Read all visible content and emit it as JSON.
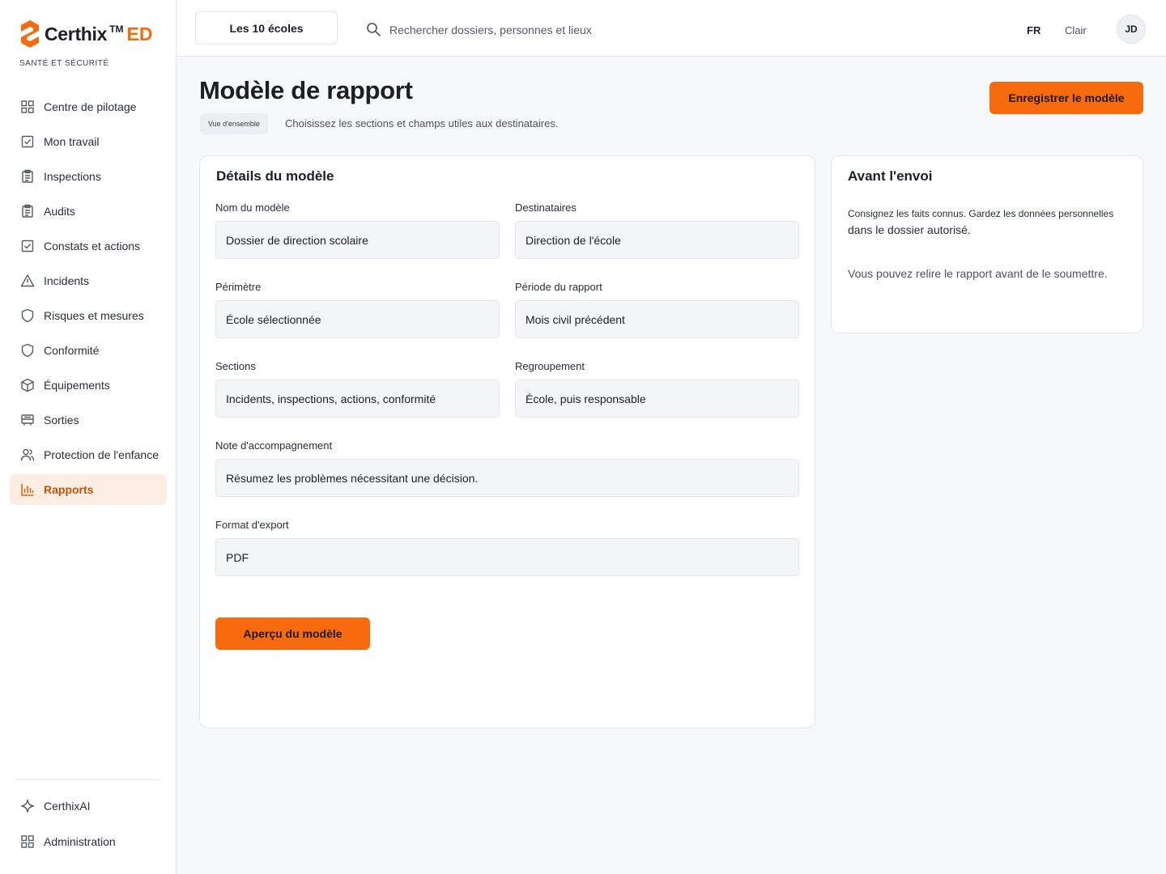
{
  "brand": {
    "name": "Certhix",
    "tm": "TM",
    "suffix": "ED",
    "subtitle": "SANTÉ ET SÉCURITÉ",
    "accent": "#f26b0f"
  },
  "sidebar": {
    "items": [
      {
        "label": "Centre de pilotage",
        "icon": "grid-icon",
        "active": false
      },
      {
        "label": "Mon travail",
        "icon": "checkbox-icon",
        "active": false
      },
      {
        "label": "Inspections",
        "icon": "clipboard-icon",
        "active": false
      },
      {
        "label": "Audits",
        "icon": "clipboard-icon",
        "active": false
      },
      {
        "label": "Constats et actions",
        "icon": "checkbox-icon",
        "active": false
      },
      {
        "label": "Incidents",
        "icon": "warning-icon",
        "active": false
      },
      {
        "label": "Risques et mesures",
        "icon": "shield-icon",
        "active": false
      },
      {
        "label": "Conformité",
        "icon": "shield-icon",
        "active": false
      },
      {
        "label": "Équipements",
        "icon": "box-icon",
        "active": false
      },
      {
        "label": "Sorties",
        "icon": "bus-icon",
        "active": false
      },
      {
        "label": "Protection de l'enfance",
        "icon": "users-icon",
        "active": false
      },
      {
        "label": "Rapports",
        "icon": "bar-chart-icon",
        "active": true
      }
    ],
    "bottom": [
      {
        "label": "CerthixAI",
        "icon": "sparkle-icon"
      },
      {
        "label": "Administration",
        "icon": "grid-icon"
      }
    ]
  },
  "topbar": {
    "school_selector": "Les 10 écoles",
    "search_placeholder": "Rechercher dossiers, personnes et lieux",
    "language": "FR",
    "theme": "Clair",
    "avatar_initials": "JD"
  },
  "page": {
    "title": "Modèle de rapport",
    "badge": "Vue d'ensemble",
    "subtitle": "Choisissez les sections et champs utiles aux destinataires.",
    "save_label": "Enregistrer le modèle"
  },
  "details": {
    "title": "Détails du modèle",
    "fields": {
      "name": {
        "label": "Nom du modèle",
        "value": "Dossier de direction scolaire"
      },
      "recipients": {
        "label": "Destinataires",
        "value": "Direction de l'école"
      },
      "scope": {
        "label": "Périmètre",
        "value": "École sélectionnée"
      },
      "period": {
        "label": "Période du rapport",
        "value": "Mois civil précédent"
      },
      "sections": {
        "label": "Sections",
        "value": "Incidents, inspections, actions, conformité"
      },
      "grouping": {
        "label": "Regroupement",
        "value": "École, puis responsable"
      },
      "note": {
        "label": "Note d'accompagnement",
        "value": "Résumez les problèmes nécessitant une décision."
      },
      "format": {
        "label": "Format d'export",
        "value": "PDF"
      }
    },
    "preview_label": "Aperçu du modèle"
  },
  "side": {
    "title": "Avant l'envoi",
    "line1": "Consignez les faits connus. Gardez les données personnelles",
    "line2": "dans le dossier autorisé.",
    "line3": "Vous pouvez relire le rapport avant de le soumettre."
  }
}
